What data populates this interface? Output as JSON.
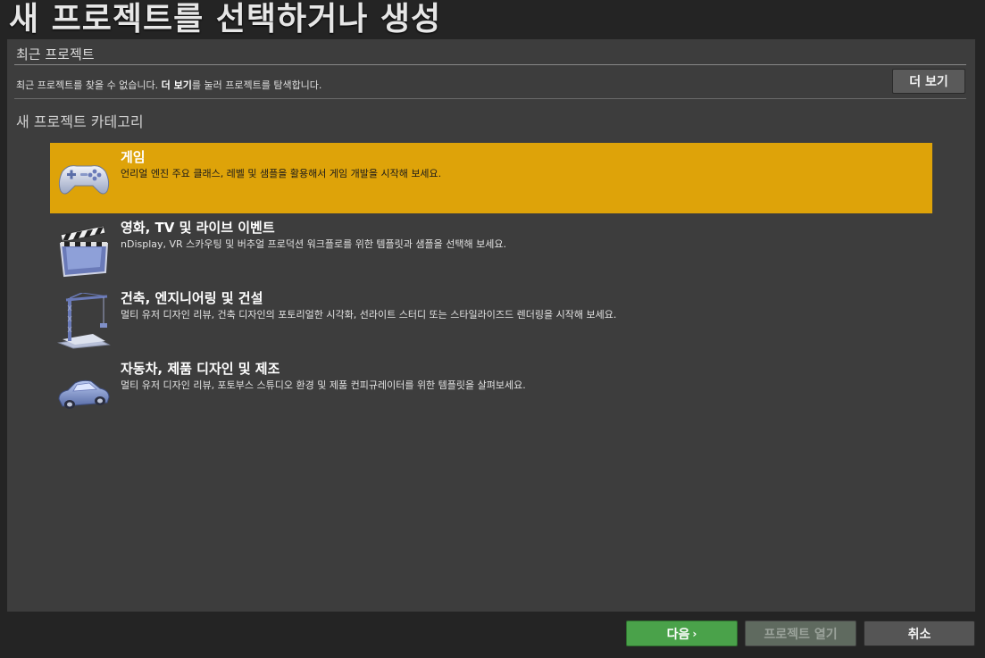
{
  "window": {
    "title": "새 프로젝트를 선택하거나 생성"
  },
  "recent": {
    "heading": "최근 프로젝트",
    "message_prefix": "최근 프로젝트를 찾을 수 없습니다. ",
    "message_bold": "더 보기",
    "message_suffix": "를 눌러 프로젝트를 탐색합니다.",
    "more_button": "더 보기"
  },
  "categories": {
    "heading": "새 프로젝트 카테고리",
    "items": [
      {
        "title": "게임",
        "description": "언리얼 엔진 주요 클래스, 레벨 및 샘플을 활용해서 게임 개발을 시작해 보세요.",
        "icon": "gamepad-icon",
        "selected": true
      },
      {
        "title": "영화, TV 및 라이브 이벤트",
        "description": "nDisplay, VR 스카우팅 및 버추얼 프로덕션 워크플로를 위한 템플릿과 샘플을 선택해 보세요.",
        "icon": "clapperboard-icon",
        "selected": false
      },
      {
        "title": "건축, 엔지니어링 및 건설",
        "description": "멀티 유저 디자인 리뷰, 건축 디자인의 포토리얼한 시각화, 선라이트 스터디 또는 스타일라이즈드 렌더링을 시작해 보세요.",
        "icon": "crane-icon",
        "selected": false
      },
      {
        "title": "자동차, 제품 디자인 및 제조",
        "description": "멀티 유저 디자인 리뷰, 포토부스 스튜디오 환경 및 제품 컨피규레이터를 위한 템플릿을 살펴보세요.",
        "icon": "car-icon",
        "selected": false
      }
    ]
  },
  "footer": {
    "next_label": "다음",
    "next_glyph": "›",
    "open_label": "프로젝트 열기",
    "cancel_label": "취소"
  },
  "colors": {
    "selected_bg": "#dea309",
    "next_bg": "#4aa24a",
    "panel_bg": "#3d3d3d",
    "window_bg": "#242424"
  }
}
